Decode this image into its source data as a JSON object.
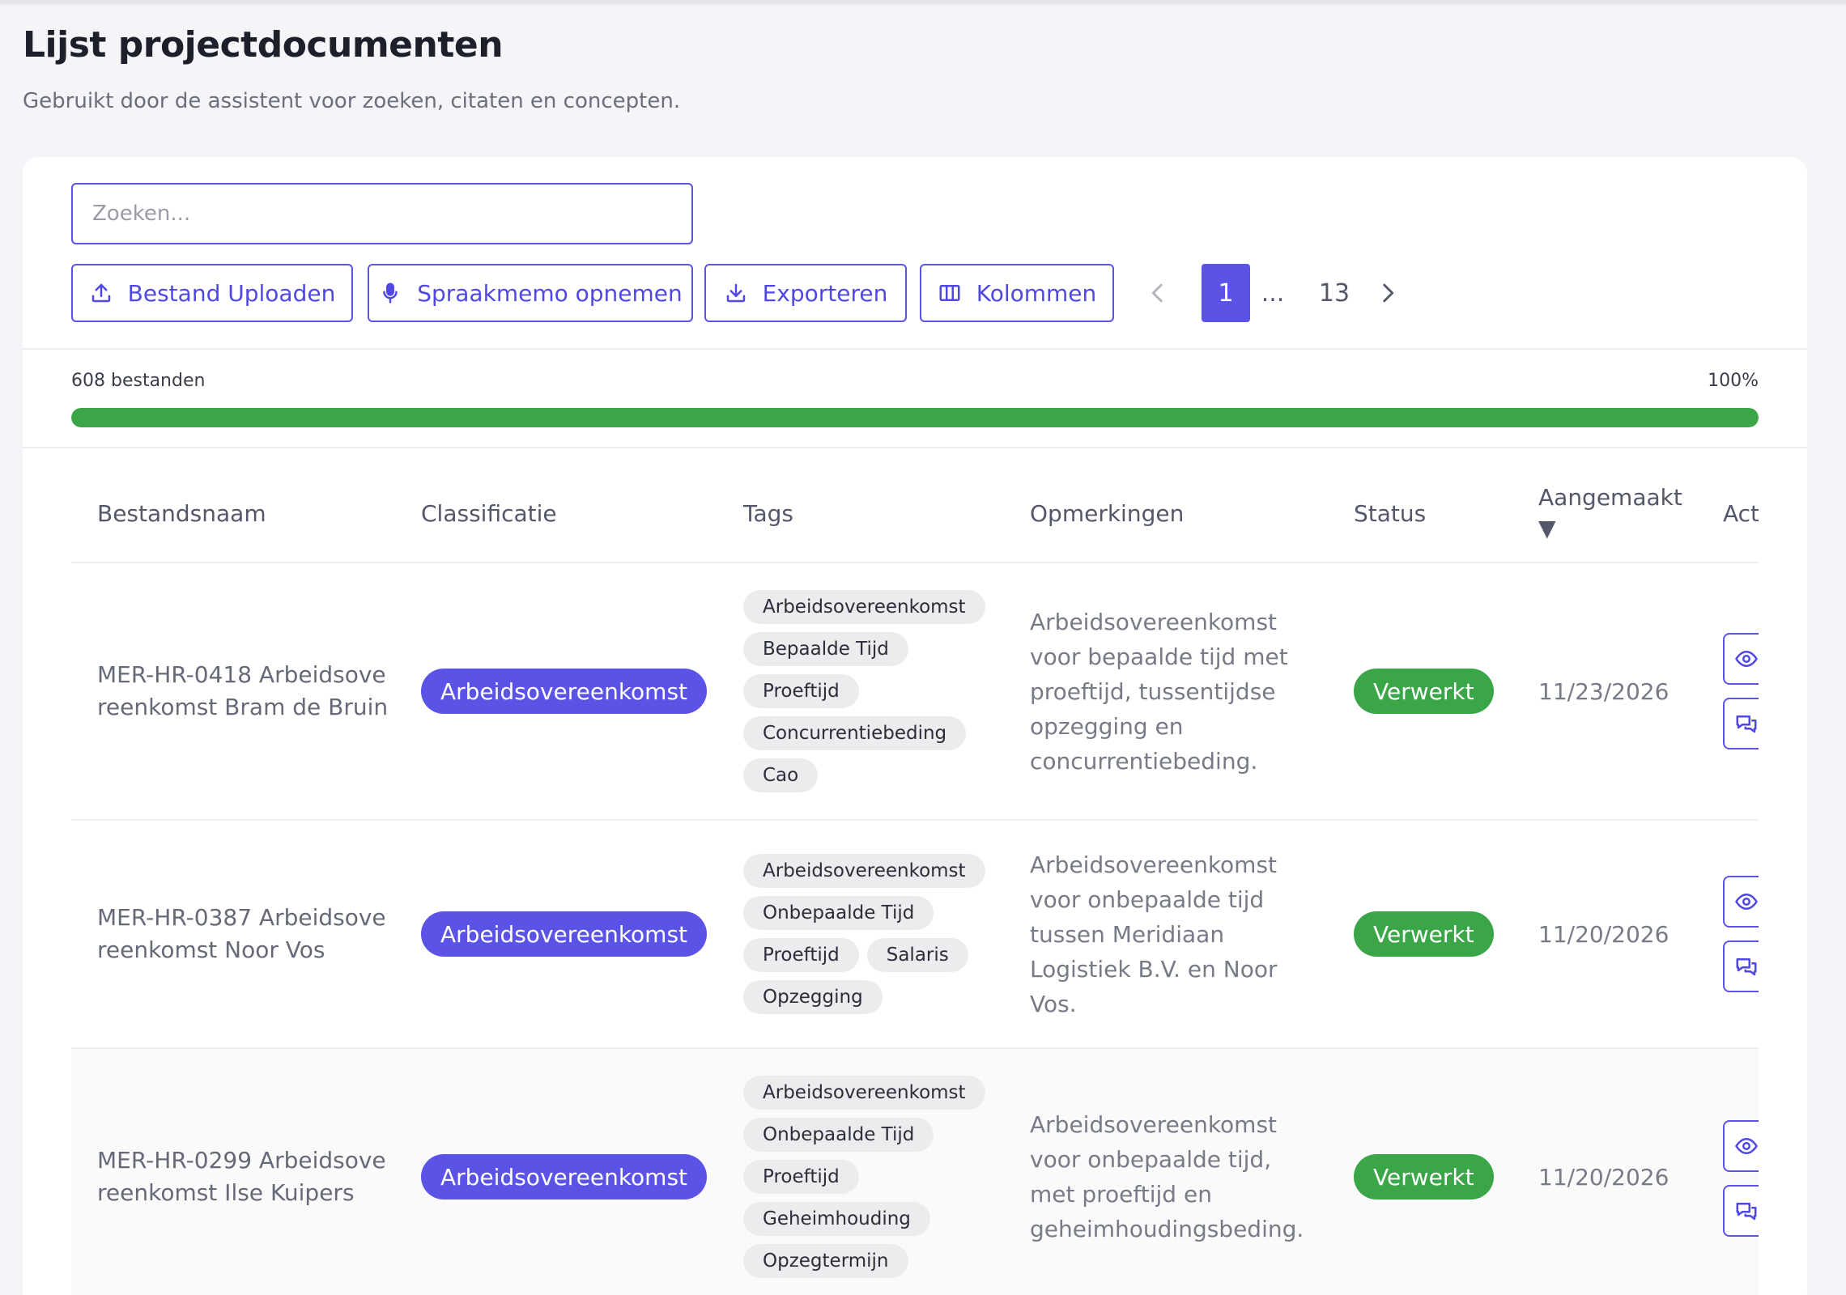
{
  "page": {
    "title": "Lijst projectdocumenten",
    "subtitle": "Gebruikt door de assistent voor zoeken, citaten en concepten."
  },
  "search": {
    "placeholder": "Zoeken...",
    "value": ""
  },
  "toolbar": {
    "upload_label": "Bestand Uploaden",
    "voice_label": "Spraakmemo opnemen",
    "export_label": "Exporteren",
    "columns_label": "Kolommen"
  },
  "pagination": {
    "current": "1",
    "ellipsis": "...",
    "last": "13"
  },
  "progress": {
    "count_text": "608 bestanden",
    "percent_text": "100%",
    "value": 1.0
  },
  "table": {
    "headers": {
      "filename": "Bestandsnaam",
      "classification": "Classificatie",
      "tags": "Tags",
      "remarks": "Opmerkingen",
      "status": "Status",
      "created": "Aangemaakt",
      "sort_indicator": "▼",
      "actions": "Act"
    },
    "rows": [
      {
        "filename": "MER-HR-0418 Arbeidsovereenkomst Bram de Bruin",
        "classification": "Arbeidsovereenkomst",
        "tags": [
          "Arbeidsovereenkomst",
          "Bepaalde Tijd",
          "Proeftijd",
          "Concurrentiebeding",
          "Cao"
        ],
        "remark": "Arbeidsovereenkomst voor bepaalde tijd met proeftijd, tussentijdse opzegging en concurrentiebeding.",
        "status": "Verwerkt",
        "created": "11/23/2026"
      },
      {
        "filename": "MER-HR-0387 Arbeidsovereenkomst Noor Vos",
        "classification": "Arbeidsovereenkomst",
        "tags": [
          "Arbeidsovereenkomst",
          "Onbepaalde Tijd",
          "Proeftijd",
          "Salaris",
          "Opzegging"
        ],
        "remark": "Arbeidsovereenkomst voor onbepaalde tijd tussen Meridiaan Logistiek B.V. en Noor Vos.",
        "status": "Verwerkt",
        "created": "11/20/2026"
      },
      {
        "filename": "MER-HR-0299 Arbeidsovereenkomst Ilse Kuipers",
        "classification": "Arbeidsovereenkomst",
        "tags": [
          "Arbeidsovereenkomst",
          "Onbepaalde Tijd",
          "Proeftijd",
          "Geheimhouding",
          "Opzegtermijn"
        ],
        "remark": "Arbeidsovereenkomst voor onbepaalde tijd, met proeftijd en geheimhoudingsbeding.",
        "status": "Verwerkt",
        "created": "11/20/2026"
      }
    ]
  },
  "colors": {
    "accent": "#5b52e6",
    "success": "#3aa648",
    "tag_bg": "#ececef"
  },
  "icons": {
    "upload": "upload-icon",
    "voice": "microphone-icon",
    "export": "download-icon",
    "columns": "columns-icon",
    "prev": "chevron-left-icon",
    "next": "chevron-right-icon",
    "view": "eye-icon",
    "comment": "chat-icon"
  }
}
